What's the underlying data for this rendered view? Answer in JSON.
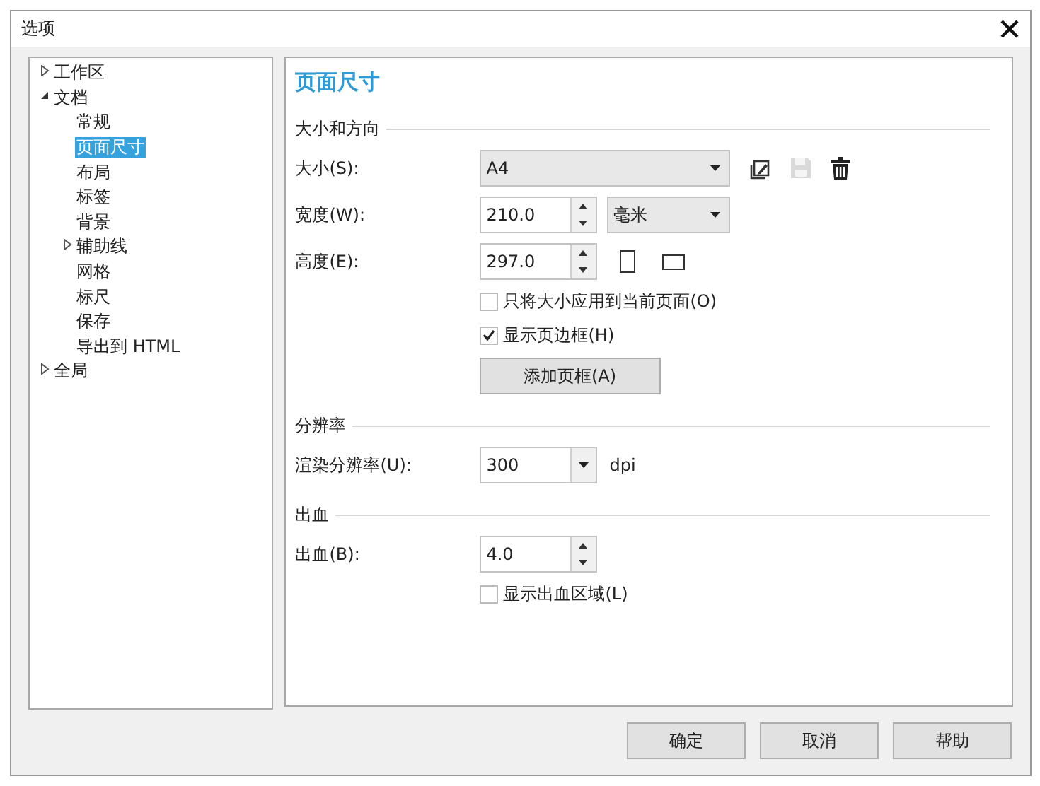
{
  "window": {
    "title": "选项"
  },
  "tree": [
    {
      "label": "工作区",
      "expanded": false,
      "selected": false
    },
    {
      "label": "文档",
      "expanded": true,
      "selected": false,
      "children": [
        {
          "label": "常规",
          "selected": false
        },
        {
          "label": "页面尺寸",
          "selected": true
        },
        {
          "label": "布局",
          "selected": false
        },
        {
          "label": "标签",
          "selected": false
        },
        {
          "label": "背景",
          "selected": false
        },
        {
          "label": "辅助线",
          "expanded": false,
          "selected": false
        },
        {
          "label": "网格",
          "selected": false
        },
        {
          "label": "标尺",
          "selected": false
        },
        {
          "label": "保存",
          "selected": false
        },
        {
          "label": "导出到 HTML",
          "selected": false
        }
      ]
    },
    {
      "label": "全局",
      "expanded": false,
      "selected": false
    }
  ],
  "page": {
    "title": "页面尺寸",
    "sections": [
      {
        "heading": "大小和方向",
        "rows": [
          {
            "kind": "preset",
            "label": "大小(S):",
            "value": "A4",
            "tools": [
              {
                "kind": "edit",
                "disabled": false
              },
              {
                "kind": "save",
                "disabled": true
              },
              {
                "kind": "delete",
                "disabled": false
              }
            ]
          },
          {
            "kind": "spin",
            "label": "宽度(W):",
            "value": "210.0",
            "unit": "毫米"
          },
          {
            "kind": "spin",
            "label": "高度(E):",
            "value": "297.0",
            "icons": [
              {
                "kind": "portrait"
              },
              {
                "kind": "landscape"
              }
            ]
          },
          {
            "kind": "check",
            "label": "只将大小应用到当前页面(O)",
            "checked": false
          },
          {
            "kind": "check",
            "label": "显示页边框(H)",
            "checked": true
          },
          {
            "kind": "button",
            "label": "添加页框(A)"
          }
        ]
      },
      {
        "heading": "分辨率",
        "rows": [
          {
            "kind": "combo",
            "label": "渲染分辨率(U):",
            "value": "300",
            "suffix": "dpi"
          }
        ]
      },
      {
        "heading": "出血",
        "rows": [
          {
            "kind": "spin",
            "label": "出血(B):",
            "value": "4.0"
          },
          {
            "kind": "check",
            "label": "显示出血区域(L)",
            "checked": false
          }
        ]
      }
    ]
  },
  "buttons": [
    "确定",
    "取消",
    "帮助"
  ]
}
